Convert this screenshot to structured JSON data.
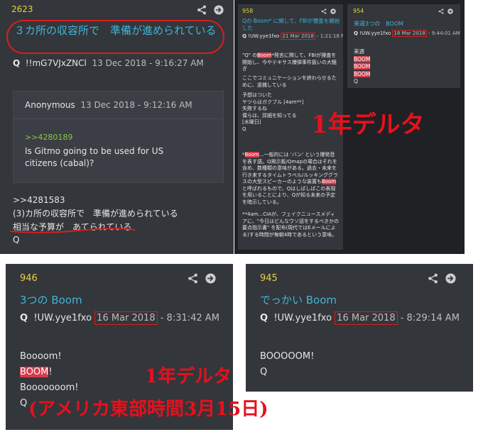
{
  "post_2623": {
    "number": "2623",
    "title": "３カ所の収容所で　準備が進められている",
    "author": "Q",
    "trip": "!!mG7VJxZNCl",
    "date": "13 Dec 2018 - 9:16:27 AM",
    "quote": {
      "author": "Anonymous",
      "date": "13 Dec 2018 - 9:12:16 AM",
      "ref": ">>4280189",
      "text": "Is Gitmo going to be used for US citizens (cabal)?"
    },
    "ref": ">>4281583",
    "line1": "(3)カ所の収容所で　準備が進められている",
    "line2": "相当な予算が　あてられている",
    "sign": "Q"
  },
  "post_958": {
    "number": "958",
    "title": "Qの Boom* に関して、FBIが捜査を開始した",
    "author": "Q",
    "trip": "!UW.yye1fxo",
    "date_boxed": "21 Mar 2018",
    "time": "- 1:21:18 PM",
    "para1_pre": "\"Q\" の",
    "para1_boom": "Boom",
    "para1_post": "*発言に関して、FBIが捜査を開始し、今やテキサス爆弾事件扱いの大騒ぎ",
    "para2": "ここでコミュニケーションを終わらせるために、遠捕している",
    "lines": [
      "予想はついた",
      "ヤツらはガクブル [4am**]",
      "失敗するね",
      "僕らは、詳細を知ってる",
      "[水曜日]",
      "Q"
    ],
    "note_pre": "*",
    "note_boom1": "Boom",
    "note_mid1": "…一般的には 'バン' という爆発音を表す語。Q掲示板/Qmapの場合はそれを含め、数種類の意味がある。過去・未来を行き来するタイムトラベル/ルッキンググラスの大型スピーカーのような装置も",
    "note_boom2": "Boom",
    "note_mid2": "と呼ばれるもので、Qはしばしばこの表現を用いることにより、Qが知る未来の予定を暗示している。",
    "note2": "**4am...CIAが、フェイクニュースメディアに、\"今日はどんなウソ話をするべきかの要点指示書\" を配布(現代ではEメールによる)する時間が毎朝4時であるという意味。"
  },
  "post_954": {
    "number": "954",
    "title": "来週3つの　BOOM",
    "author": "Q",
    "trip": "!UW.yye1fxo",
    "date_boxed": "18 Mar 2018",
    "time": "- 9:44:01 AM",
    "line1": "来週",
    "booms": [
      "BOOM",
      "BOOM",
      "BOOM"
    ],
    "sign": "Q"
  },
  "post_946": {
    "number": "946",
    "title": "3つの Boom",
    "author": "Q",
    "trip": "!UW.yye1fxo",
    "date_boxed": "16 Mar 2018",
    "time": "- 8:31:42 AM",
    "line1": "Boooom!",
    "boom": "BOOM",
    "boom_suffix": "!",
    "line3": "Booooooom!",
    "sign": "Q"
  },
  "post_945": {
    "number": "945",
    "title": "でっかい Boom",
    "author": "Q",
    "trip": "!UW.yye1fxo",
    "date_boxed": "16 Mar 2018",
    "time": "- 8:29:14 AM",
    "line1": "BOOOOOM!",
    "sign": "Q"
  },
  "overlay": {
    "delta_top": "1年デルタ",
    "delta_bottom": "1年デルタ",
    "eastern": "(アメリカ東部時間3月15日)"
  },
  "icons": [
    "share-icon",
    "arrow-right-circle-icon"
  ],
  "colors": {
    "panel_bg": "#33363b",
    "number": "#e8d33a",
    "title": "#3fb5d9",
    "boom_highlight": "#d43b4a",
    "annotation_red": "#e8101c"
  }
}
